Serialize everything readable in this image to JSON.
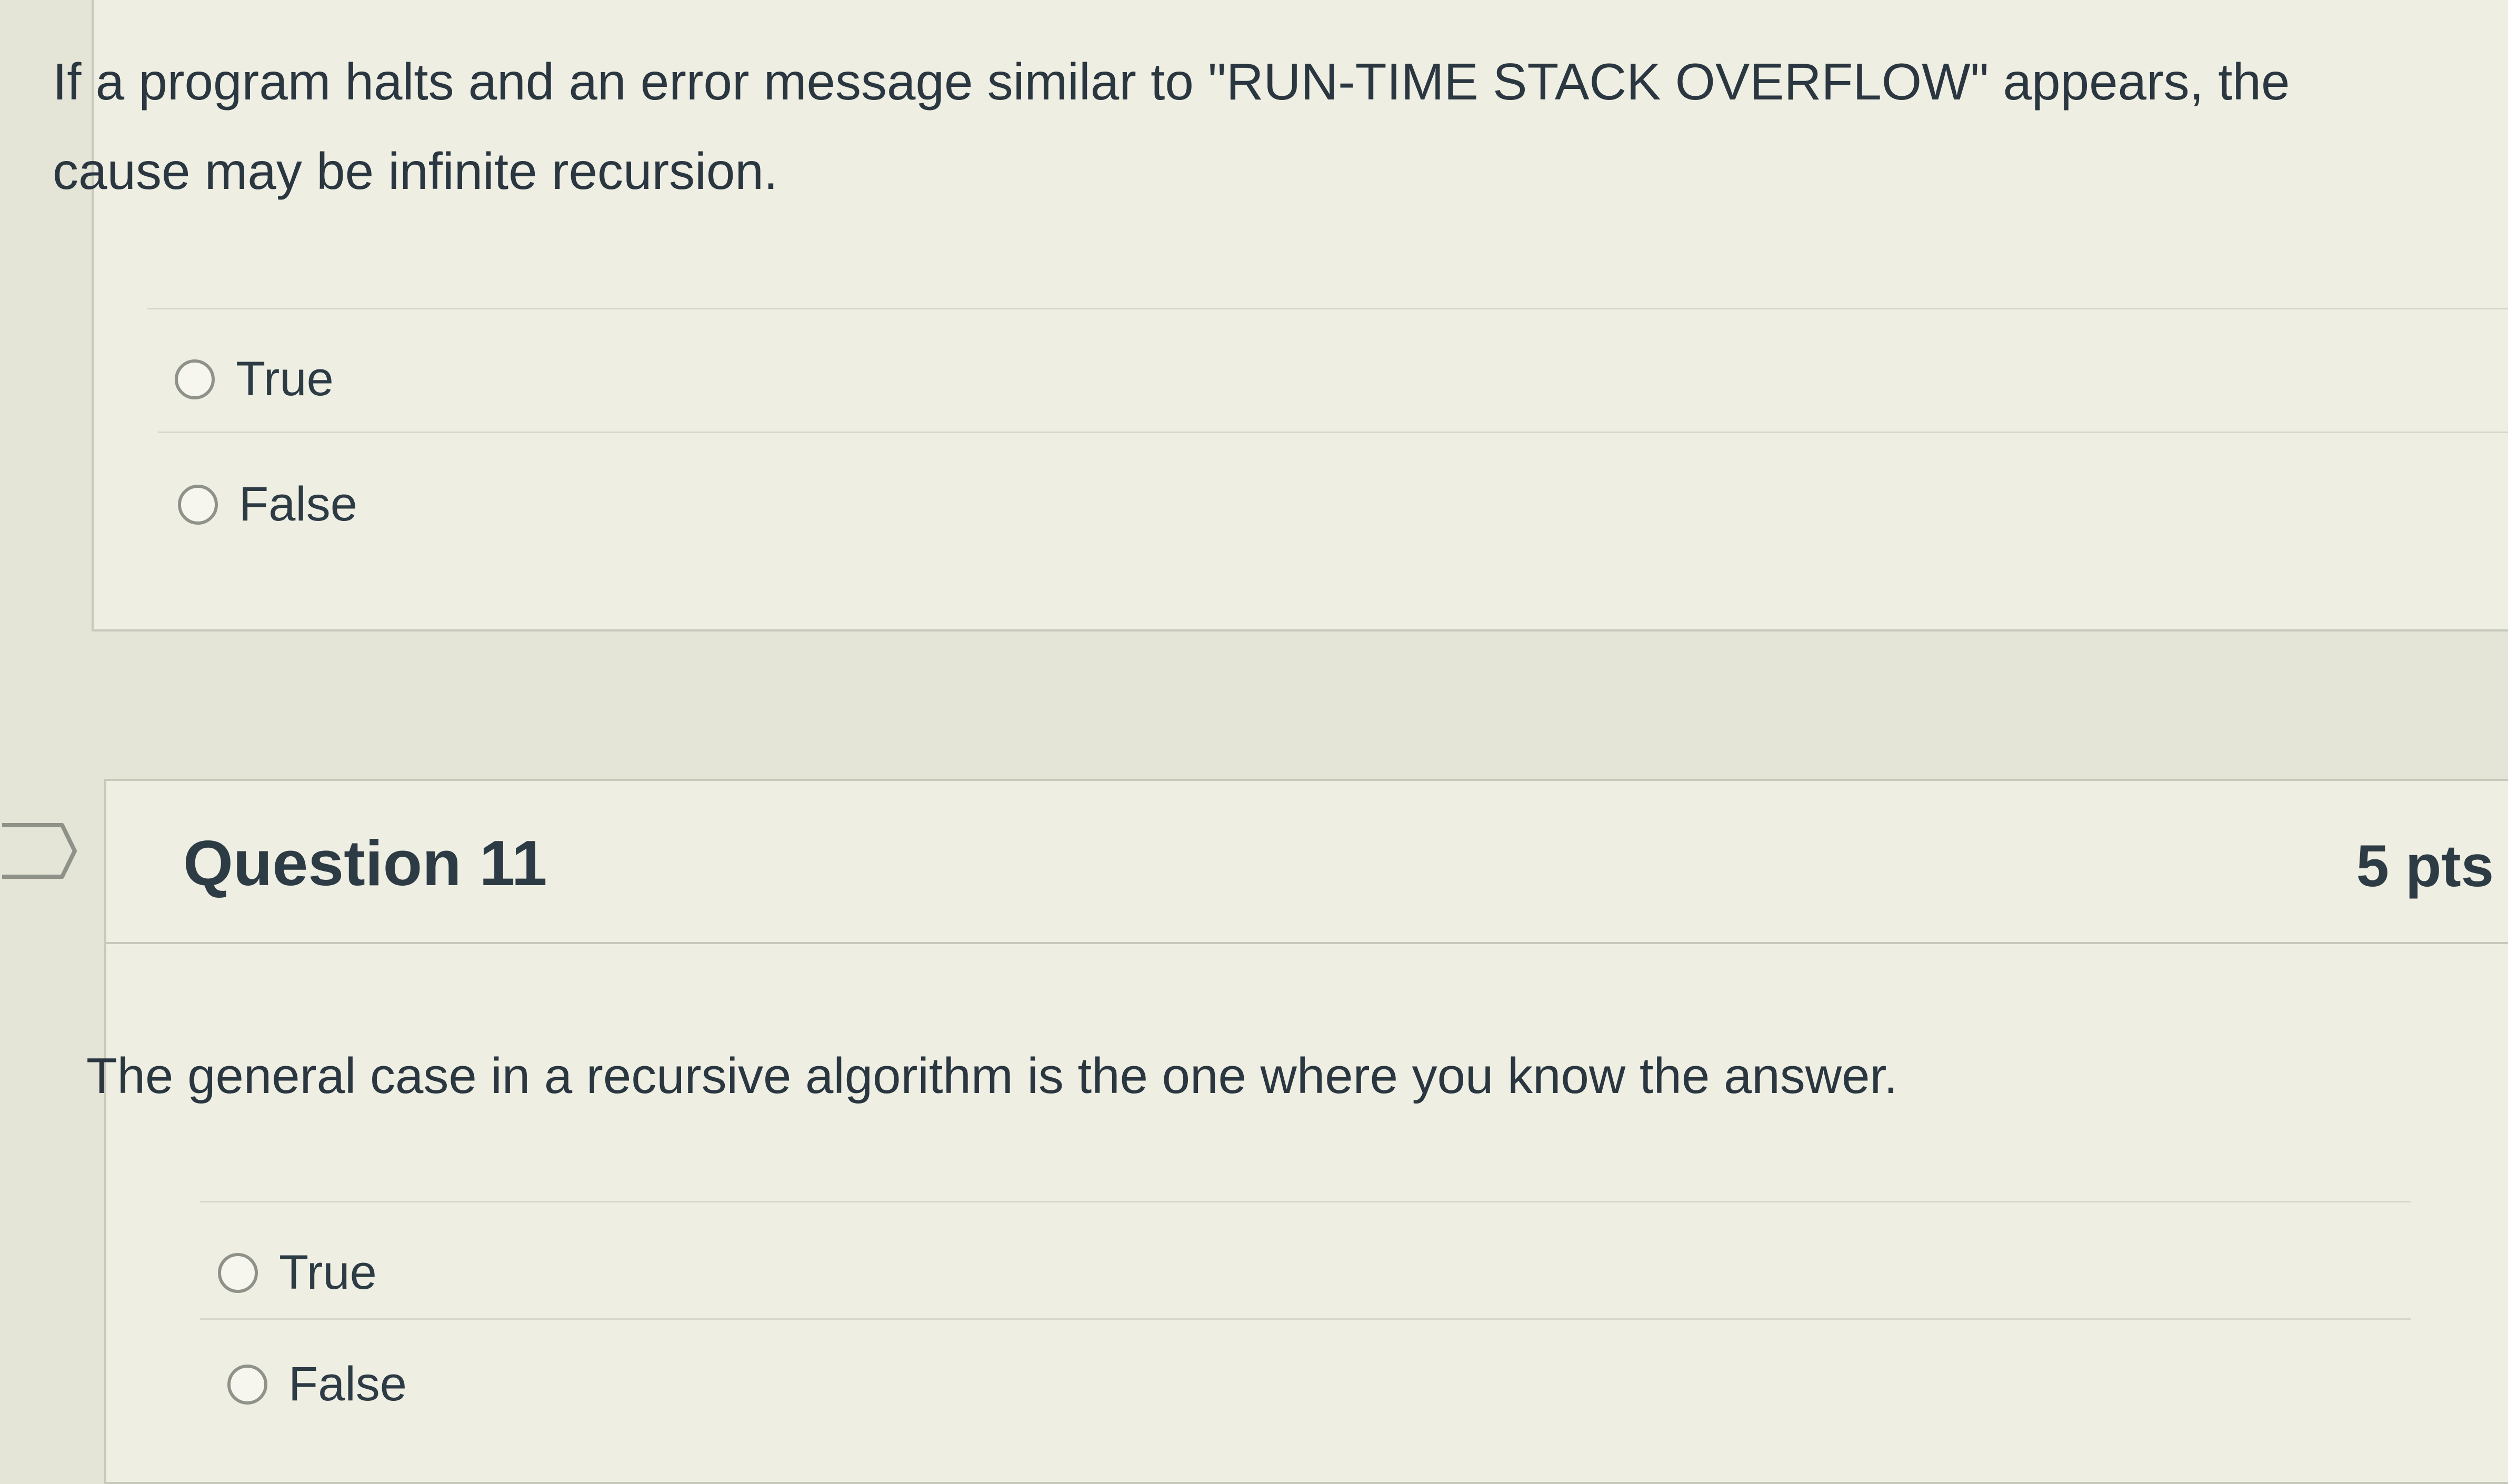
{
  "question_10": {
    "text": "If a program halts and an error message similar to \"RUN-TIME STACK OVERFLOW\" appears, the cause may be infinite recursion.",
    "options": [
      "True",
      "False"
    ]
  },
  "question_11": {
    "title": "Question 11",
    "points": "5 pts",
    "text": "The general case in a recursive algorithm is the one where you know the answer.",
    "options": [
      "True",
      "False"
    ]
  }
}
